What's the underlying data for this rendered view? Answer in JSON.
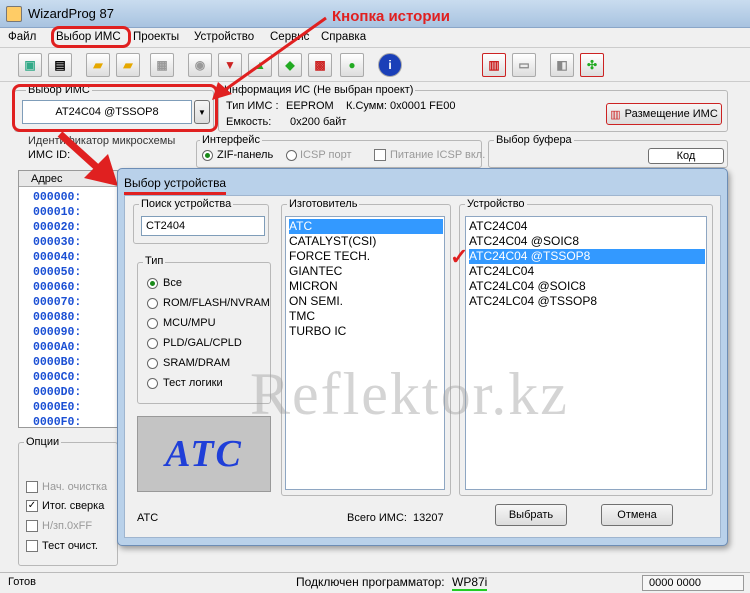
{
  "window": {
    "title": "WizardProg 87"
  },
  "menu": [
    "Файл",
    "Выбор ИМС",
    "Проекты",
    "Устройство",
    "Сервис",
    "Справка"
  ],
  "annotation": {
    "history_label": "Кнопка истории",
    "color": "#e02020"
  },
  "chip_select": {
    "label": "Выбор ИМС",
    "value": "AT24C04 @TSSOP8"
  },
  "chip_info": {
    "title": "Информация ИС (Не выбран проект)",
    "type_label": "Тип ИМС :",
    "type_value": "EEPROM",
    "checksum_label": "К.Сумм:",
    "checksum_value": "0x0001 FE00",
    "capacity_label": "Емкость:",
    "capacity_value": "0x200 байт",
    "placement_button": "Размещение ИМС"
  },
  "chip_id": {
    "label": "Идентификатор микросхемы",
    "id_label": "ИМС ID:"
  },
  "interface": {
    "label": "Интерфейс",
    "zif": "ZIF-панель",
    "icsp": "ICSP порт",
    "power": "Питание ICSP вкл."
  },
  "buffer": {
    "label": "Выбор буфера",
    "code": "Код"
  },
  "address": {
    "header": "Адрес",
    "rows": [
      "000000:",
      "000010:",
      "000020:",
      "000030:",
      "000040:",
      "000050:",
      "000060:",
      "000070:",
      "000080:",
      "000090:",
      "0000A0:",
      "0000B0:",
      "0000C0:",
      "0000D0:",
      "0000E0:",
      "0000F0:"
    ]
  },
  "options": {
    "label": "Опции",
    "items": [
      "Нач. очистка",
      "Итог. сверка",
      "Н/зп.0xFF",
      "Тест очист."
    ]
  },
  "dialog": {
    "title": "Выбор устройства",
    "search_label": "Поиск устройства",
    "search_value": "CT2404",
    "type_label": "Тип",
    "types": [
      "Все",
      "ROM/FLASH/NVRAM",
      "MCU/MPU",
      "PLD/GAL/CPLD",
      "SRAM/DRAM",
      "Тест логики"
    ],
    "manufacturer_label": "Изготовитель",
    "manufacturers": [
      "ATC",
      "CATALYST(CSI)",
      "FORCE TECH.",
      "GIANTEC",
      "MICRON",
      "ON SEMI.",
      "TMC",
      "TURBO IC"
    ],
    "device_label": "Устройство",
    "devices": [
      "ATC24C04",
      "ATC24C04 @SOIC8",
      "ATC24C04 @TSSOP8",
      "ATC24LC04",
      "ATC24LC04 @SOIC8",
      "ATC24LC04 @TSSOP8"
    ],
    "logo": "ATC",
    "footer_maker": "ATC",
    "total_label": "Всего ИМС:",
    "total_value": "13207",
    "select_button": "Выбрать",
    "cancel_button": "Отмена"
  },
  "watermark": "Reflektor.kz",
  "status": {
    "ready": "Готов",
    "connected_label": "Подключен программатор:",
    "programmer": "WP87i",
    "code": "0000 0000"
  }
}
